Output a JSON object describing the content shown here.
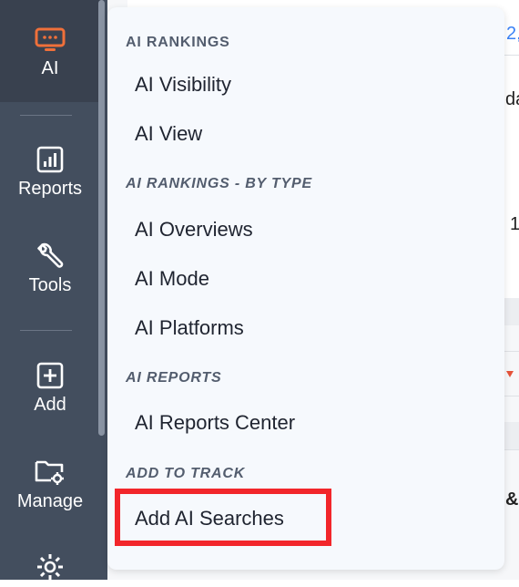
{
  "sidebar": {
    "items": [
      {
        "label": "AI",
        "icon": "ai-monitor-icon",
        "active": true
      },
      {
        "label": "Reports",
        "icon": "bar-chart-icon"
      },
      {
        "label": "Tools",
        "icon": "wrench-icon"
      },
      {
        "label": "Add",
        "icon": "plus-square-icon"
      },
      {
        "label": "Manage",
        "icon": "folder-gear-icon"
      },
      {
        "label": "",
        "icon": "settings-gear-icon"
      }
    ],
    "accent": "#f0703a"
  },
  "background": {
    "fragments": [
      "2,",
      "da",
      "1",
      "&"
    ]
  },
  "menu": {
    "sections": [
      {
        "title": "AI RANKINGS",
        "items": [
          "AI Visibility",
          "AI View"
        ]
      },
      {
        "title": "AI RANKINGS - BY TYPE",
        "items": [
          "AI Overviews",
          "AI Mode",
          "AI Platforms"
        ]
      },
      {
        "title": "AI REPORTS",
        "items": [
          "AI Reports Center"
        ]
      },
      {
        "title": "ADD TO TRACK",
        "items": [
          "Add AI Searches"
        ]
      }
    ],
    "highlight_color": "#f2262b"
  }
}
